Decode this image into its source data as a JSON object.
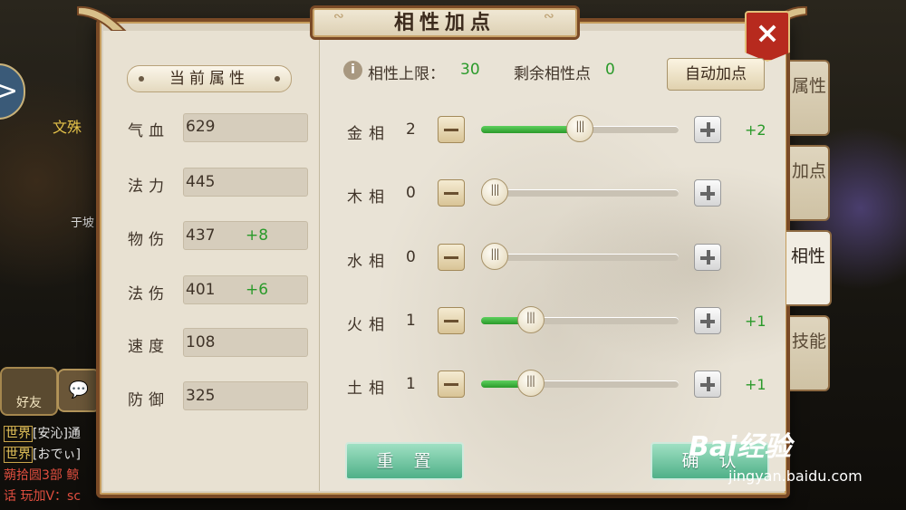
{
  "window": {
    "title": "相性加点"
  },
  "close_label": "×",
  "left_panel": {
    "header": "当前属性",
    "stats": [
      {
        "label": "气血",
        "value": "629",
        "bonus": ""
      },
      {
        "label": "法力",
        "value": "445",
        "bonus": ""
      },
      {
        "label": "物伤",
        "value": "437",
        "bonus": "+8"
      },
      {
        "label": "法伤",
        "value": "401",
        "bonus": "+6"
      },
      {
        "label": "速度",
        "value": "108",
        "bonus": ""
      },
      {
        "label": "防御",
        "value": "325",
        "bonus": ""
      }
    ]
  },
  "right_panel": {
    "info_icon": "i",
    "limit_label": "相性上限：",
    "limit_value": "30",
    "remaining_label": "剩余相性点",
    "remaining_value": "0",
    "auto_button": "自动加点",
    "elements": [
      {
        "label": "金相",
        "value": "2",
        "bonus": "+2",
        "fill": 0.5
      },
      {
        "label": "木相",
        "value": "0",
        "bonus": "",
        "fill": 0
      },
      {
        "label": "水相",
        "value": "0",
        "bonus": "",
        "fill": 0
      },
      {
        "label": "火相",
        "value": "1",
        "bonus": "+1",
        "fill": 0.25
      },
      {
        "label": "土相",
        "value": "1",
        "bonus": "+1",
        "fill": 0.25
      }
    ],
    "reset_button": "重置",
    "confirm_button": "确认"
  },
  "tabs": [
    {
      "label": "属性",
      "active": false
    },
    {
      "label": "加点",
      "active": false
    },
    {
      "label": "相性",
      "active": true
    },
    {
      "label": "技能",
      "active": false
    }
  ],
  "background": {
    "side_arrow": ">",
    "npc_name": "文殊",
    "npc_name2": "于坡",
    "friend_button": "好友",
    "chat_lines": [
      {
        "tag": "世界",
        "text": "[安沁]通"
      },
      {
        "tag": "世界",
        "text": "[おでぃ]"
      },
      {
        "tag": "",
        "text": "蒴拾圆3部 鲸"
      },
      {
        "tag": "",
        "text": "话 玩加V：sc"
      }
    ]
  },
  "watermark": {
    "brand": "Bai经验",
    "url": "jingyan.baidu.com"
  },
  "colors": {
    "accent_green": "#2a9a2a",
    "frame_brown": "#7a4a26",
    "close_red": "#b72a1e",
    "button_teal": "#4fb088"
  }
}
